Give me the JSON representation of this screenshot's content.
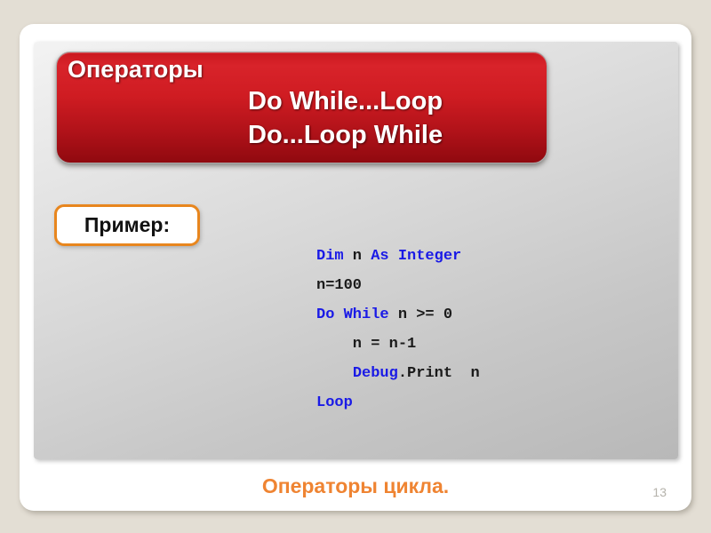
{
  "slide": {
    "header": {
      "title": "Операторы",
      "subtitle_line1": "Do While...Loop",
      "subtitle_line2": "Do...Loop While",
      "background_color": "#c9171e"
    },
    "example_badge": {
      "label": "Пример:",
      "border_color": "#e8861e"
    },
    "code": {
      "language": "Visual Basic",
      "keyword_color": "#1a1ae6",
      "plain_color": "#1a1a1a",
      "lines": [
        {
          "tokens": [
            {
              "text": "Dim",
              "type": "kw"
            },
            {
              "text": " n ",
              "type": "pln"
            },
            {
              "text": "As Integer",
              "type": "kw"
            }
          ]
        },
        {
          "tokens": [
            {
              "text": "n=100",
              "type": "pln"
            }
          ]
        },
        {
          "tokens": [
            {
              "text": "Do While",
              "type": "kw"
            },
            {
              "text": " n >= 0",
              "type": "pln"
            }
          ]
        },
        {
          "tokens": [
            {
              "text": "    n = n-1",
              "type": "pln"
            }
          ]
        },
        {
          "tokens": [
            {
              "text": "    ",
              "type": "pln"
            },
            {
              "text": "Debug",
              "type": "kw"
            },
            {
              "text": ".Print  n",
              "type": "pln"
            }
          ]
        },
        {
          "tokens": [
            {
              "text": "Loop",
              "type": "kw"
            }
          ]
        }
      ]
    },
    "footer": {
      "caption": "Операторы цикла.",
      "caption_color": "#ef8432",
      "page_number": "13"
    }
  }
}
